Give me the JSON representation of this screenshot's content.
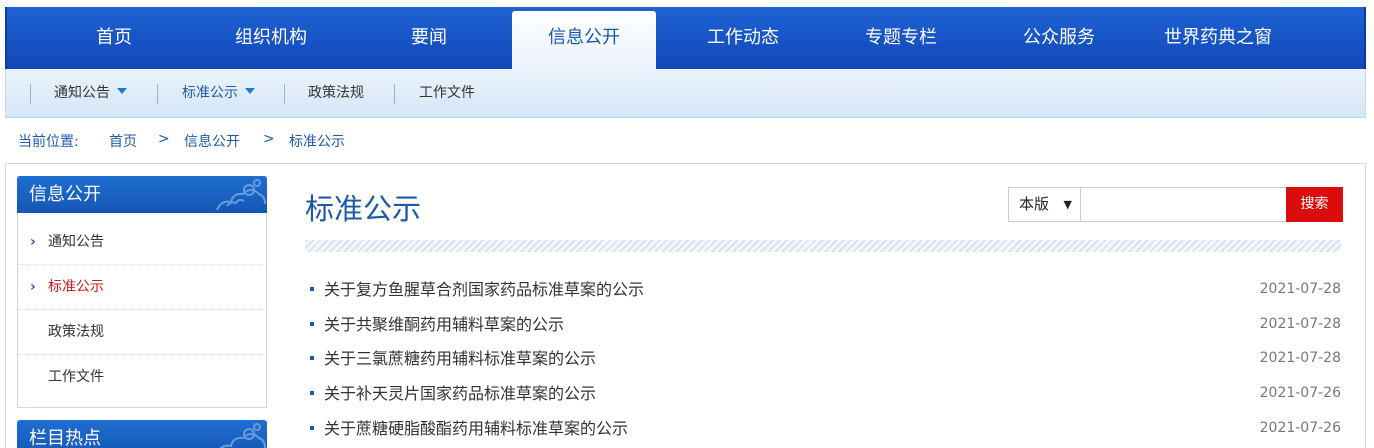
{
  "nav": {
    "items": [
      "首页",
      "组织机构",
      "要闻",
      "信息公开",
      "工作动态",
      "专题专栏",
      "公众服务",
      "世界药典之窗"
    ],
    "active": "信息公开"
  },
  "subnav": {
    "items": [
      {
        "label": "通知公告",
        "dropdown": true
      },
      {
        "label": "标准公示",
        "dropdown": true
      },
      {
        "label": "政策法规",
        "dropdown": false
      },
      {
        "label": "工作文件",
        "dropdown": false
      }
    ],
    "active": "标准公示"
  },
  "breadcrumb": {
    "prefix": "当前位置:",
    "items": [
      "首页",
      "信息公开",
      "标准公示"
    ],
    "separator": ">"
  },
  "sidebar": {
    "heading": "信息公开",
    "items": [
      "通知公告",
      "标准公示",
      "政策法规",
      "工作文件"
    ],
    "active": "标准公示",
    "second_heading": "栏目热点"
  },
  "main": {
    "title": "标准公示",
    "search": {
      "scope": "本版",
      "query": "",
      "button": "搜索"
    },
    "list": [
      {
        "title": "关于复方鱼腥草合剂国家药品标准草案的公示",
        "date": "2021-07-28"
      },
      {
        "title": "关于共聚维酮药用辅料草案的公示",
        "date": "2021-07-28"
      },
      {
        "title": "关于三氯蔗糖药用辅料标准草案的公示",
        "date": "2021-07-28"
      },
      {
        "title": "关于补天灵片国家药品标准草案的公示",
        "date": "2021-07-26"
      },
      {
        "title": "关于蔗糖硬脂酸酯药用辅料标准草案的公示",
        "date": "2021-07-26"
      }
    ]
  },
  "colors": {
    "nav_blue": "#1a55c2",
    "link_blue": "#1f5aa6",
    "active_red": "#c81d1d",
    "search_red": "#dc0c0c"
  }
}
